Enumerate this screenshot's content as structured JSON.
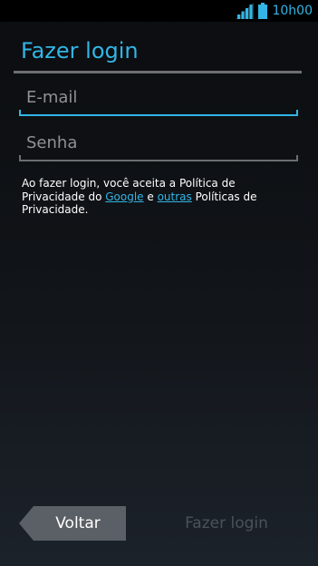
{
  "status_bar": {
    "time": "10h00",
    "accent_color": "#33b5e5",
    "icons": [
      "signal-icon",
      "battery-icon"
    ]
  },
  "page": {
    "title": "Fazer login"
  },
  "form": {
    "email": {
      "placeholder": "E-mail",
      "value": ""
    },
    "password": {
      "placeholder": "Senha",
      "value": ""
    }
  },
  "legal": {
    "prefix": " Ao fazer login, você aceita a Política de Privacidade do ",
    "link_google": "Google",
    "middle": " e ",
    "link_others": "outras",
    "suffix": " Políticas de Privacidade."
  },
  "buttons": {
    "back": "Voltar",
    "login": "Fazer login"
  }
}
